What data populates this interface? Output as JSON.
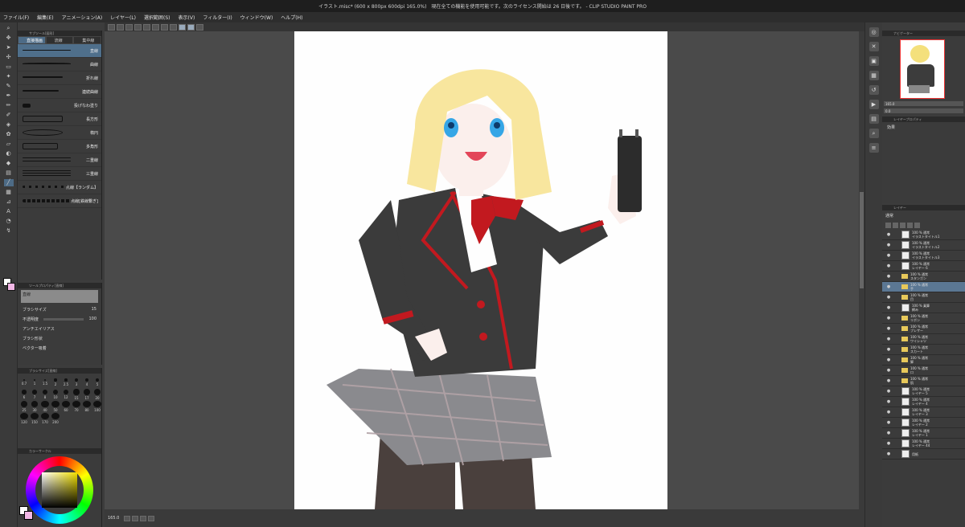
{
  "window": {
    "title": "イラスト.misc* (600 x 800px 600dpi 165.0%)　現在全ての機能を使用可能です。次のライセンス開始は 26 日後です。 - CLIP STUDIO PAINT PRO"
  },
  "menu": [
    "ファイル(F)",
    "編集(E)",
    "アニメーション(A)",
    "レイヤー(L)",
    "選択範囲(S)",
    "表示(V)",
    "フィルター(I)",
    "ウィンドウ(W)",
    "ヘルプ(H)"
  ],
  "subtool": {
    "header": "サブツール[図形]",
    "tabs": [
      "直接描画",
      "流線",
      "集中線"
    ],
    "items": [
      {
        "label": "直線",
        "selected": true
      },
      {
        "label": "曲線",
        "selected": false
      },
      {
        "label": "折れ線",
        "selected": false
      },
      {
        "label": "連続曲線",
        "selected": false
      },
      {
        "label": "投げなわ塗り",
        "selected": false
      },
      {
        "label": "長方形",
        "selected": false
      },
      {
        "label": "楕円",
        "selected": false
      },
      {
        "label": "多角形",
        "selected": false
      },
      {
        "label": "二重線",
        "selected": false
      },
      {
        "label": "三重線",
        "selected": false
      },
      {
        "label": "点線【ランダム】",
        "selected": false
      },
      {
        "label": "点線[鉄線繋ぎ]",
        "selected": false
      }
    ]
  },
  "toolprop": {
    "header": "ツールプロパティ[直線]",
    "name": "直線",
    "brush_size_label": "ブラシサイズ",
    "brush_size_value": "15",
    "opacity_label": "不透明度",
    "opacity_value": "100",
    "antialias_label": "アンチエイリアス",
    "shape_label": "ブラシ形状",
    "vector_label": "ベクター吸着"
  },
  "brushsize": {
    "header": "ブラシサイズ[直線]",
    "sizes": [
      "0.7",
      "1",
      "1.5",
      "2",
      "2.5",
      "3",
      "4",
      "5",
      "6",
      "7",
      "8",
      "10",
      "12",
      "15",
      "17",
      "20",
      "25",
      "30",
      "40",
      "50",
      "60",
      "70",
      "80",
      "100",
      "120",
      "150",
      "170",
      "200"
    ]
  },
  "colorpanel": {
    "header": "カラーサークル"
  },
  "canvasarea": {
    "zoom": "165.0"
  },
  "navigator": {
    "header": "ナビゲーター",
    "zoom": "165.0",
    "angle": "0.0"
  },
  "layerprop": {
    "header": "レイヤープロパティ",
    "effect_label": "効果"
  },
  "layerpanel": {
    "header": "レイヤー",
    "blend": "通常",
    "layers": [
      {
        "opacity": "100 % 通常",
        "name": "イラストタイトル1",
        "type": "thumb",
        "selected": false
      },
      {
        "opacity": "100 % 通常",
        "name": "イラストタイトル2",
        "type": "thumb",
        "selected": false
      },
      {
        "opacity": "100 % 通常",
        "name": "イラストタイトル3",
        "type": "thumb",
        "selected": false
      },
      {
        "opacity": "100 % 通常",
        "name": "レイヤー 6",
        "type": "thumb",
        "selected": false
      },
      {
        "opacity": "100 % 通常",
        "name": "スタンガン",
        "type": "folder",
        "selected": false
      },
      {
        "opacity": "100 % 通常",
        "name": "手",
        "type": "folder",
        "selected": true
      },
      {
        "opacity": "100 % 通常",
        "name": "目",
        "type": "folder",
        "selected": false
      },
      {
        "opacity": "100 % 乗算",
        "name": "網み",
        "type": "thumb",
        "selected": false
      },
      {
        "opacity": "100 % 通常",
        "name": "リボン",
        "type": "folder",
        "selected": false
      },
      {
        "opacity": "100 % 通常",
        "name": "ブレザー",
        "type": "folder",
        "selected": false
      },
      {
        "opacity": "100 % 通常",
        "name": "ワイシャツ",
        "type": "folder",
        "selected": false
      },
      {
        "opacity": "100 % 通常",
        "name": "スカート",
        "type": "folder",
        "selected": false
      },
      {
        "opacity": "100 % 通常",
        "name": "脚",
        "type": "folder",
        "selected": false
      },
      {
        "opacity": "100 % 通常",
        "name": "口",
        "type": "folder",
        "selected": false
      },
      {
        "opacity": "100 % 通常",
        "name": "肌",
        "type": "folder",
        "selected": false
      },
      {
        "opacity": "100 % 通常",
        "name": "レイヤー 5",
        "type": "thumb",
        "selected": false
      },
      {
        "opacity": "100 % 通常",
        "name": "レイヤー 4",
        "type": "thumb",
        "selected": false
      },
      {
        "opacity": "100 % 通常",
        "name": "レイヤー 3",
        "type": "thumb",
        "selected": false
      },
      {
        "opacity": "100 % 通常",
        "name": "レイヤー 2",
        "type": "thumb",
        "selected": false
      },
      {
        "opacity": "100 % 通常",
        "name": "レイヤー 1",
        "type": "thumb",
        "selected": false
      },
      {
        "opacity": "100 % 通常",
        "name": "レイヤー 44",
        "type": "thumb",
        "selected": false
      },
      {
        "opacity": "",
        "name": "用紙",
        "type": "thumb",
        "selected": false
      }
    ]
  },
  "colors": {
    "main_color": "#ffffff",
    "sub_color": "#f2b7e6",
    "selection": "#5b7793"
  }
}
